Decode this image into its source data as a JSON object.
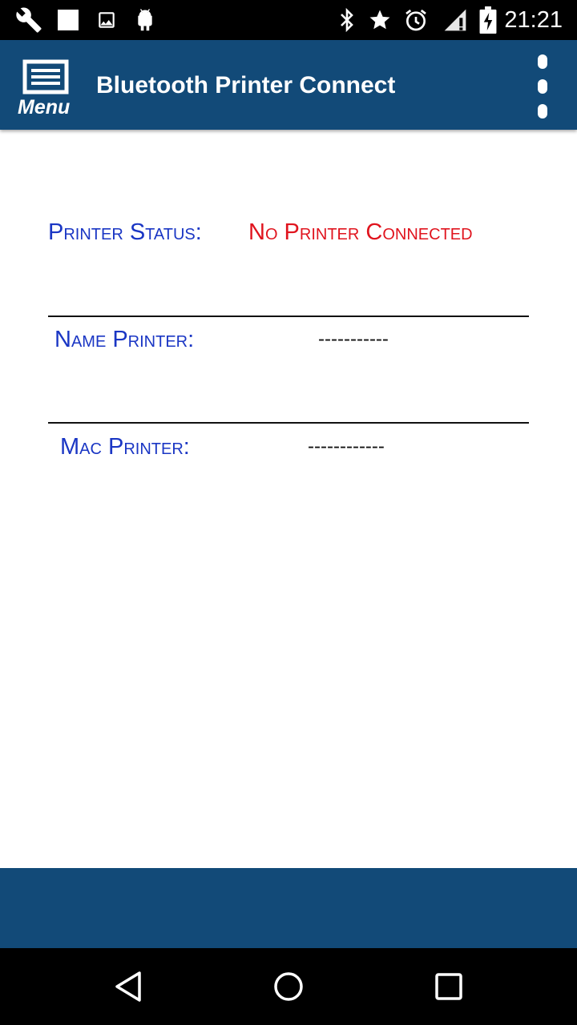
{
  "status_bar": {
    "time": "21:21",
    "left_icons": [
      "wrench-icon",
      "square-icon",
      "image-icon",
      "android-icon"
    ],
    "right_icons": [
      "bluetooth-icon",
      "star-icon",
      "alarm-icon",
      "signal-icon",
      "battery-charging-icon"
    ]
  },
  "app_bar": {
    "menu_label": "Menu",
    "title": "Bluetooth Printer Connect",
    "background": "#124a78"
  },
  "printer": {
    "status_label": "Printer Status:",
    "status_value": "No Printer Connected",
    "name_label": "Name Printer:",
    "name_value": "-----------",
    "mac_label": "Mac Printer:",
    "mac_value": "------------"
  },
  "colors": {
    "label": "#1a36c4",
    "status_error": "#e0141e",
    "bar": "#124a78"
  },
  "nav_bar": {
    "icons": [
      "back-icon",
      "home-icon",
      "recents-icon"
    ]
  }
}
